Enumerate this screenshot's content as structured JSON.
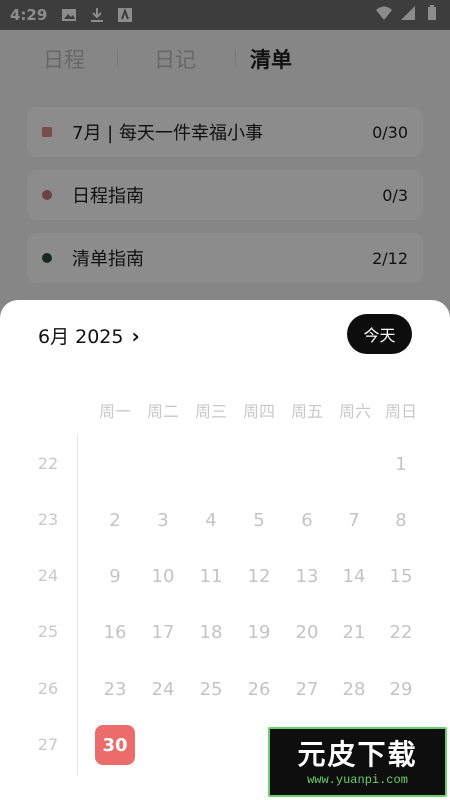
{
  "status_bar": {
    "time": "4:29"
  },
  "top_tabs": [
    {
      "label": "日程",
      "active": false
    },
    {
      "label": "日记",
      "active": false
    },
    {
      "label": "清单",
      "active": true
    }
  ],
  "lists": [
    {
      "title": "7月 | 每天一件幸福小事",
      "count": "0/30",
      "dot_color": "#d98c8c",
      "shape": "square"
    },
    {
      "title": "日程指南",
      "count": "0/3",
      "dot_color": "#c4798a",
      "shape": "circle"
    },
    {
      "title": "清单指南",
      "count": "2/12",
      "dot_color": "#2b4a3a",
      "shape": "circle"
    }
  ],
  "calendar": {
    "month_label": "6月 2025",
    "today_label": "今天",
    "weekdays": [
      "周一",
      "周二",
      "周三",
      "周四",
      "周五",
      "周六",
      "周日"
    ],
    "weeks": [
      {
        "week": "22",
        "days": [
          "",
          "",
          "",
          "",
          "",
          "",
          "1"
        ]
      },
      {
        "week": "23",
        "days": [
          "2",
          "3",
          "4",
          "5",
          "6",
          "7",
          "8"
        ]
      },
      {
        "week": "24",
        "days": [
          "9",
          "10",
          "11",
          "12",
          "13",
          "14",
          "15"
        ]
      },
      {
        "week": "25",
        "days": [
          "16",
          "17",
          "18",
          "19",
          "20",
          "21",
          "22"
        ]
      },
      {
        "week": "26",
        "days": [
          "23",
          "24",
          "25",
          "26",
          "27",
          "28",
          "29"
        ]
      },
      {
        "week": "27",
        "days": [
          "30",
          "",
          "",
          "",
          "",
          "",
          ""
        ]
      }
    ],
    "selected_day": "30",
    "selected_color": "#ec6b6b"
  },
  "watermark": {
    "text": "元皮下载",
    "url": "www.yuanpi.com"
  }
}
